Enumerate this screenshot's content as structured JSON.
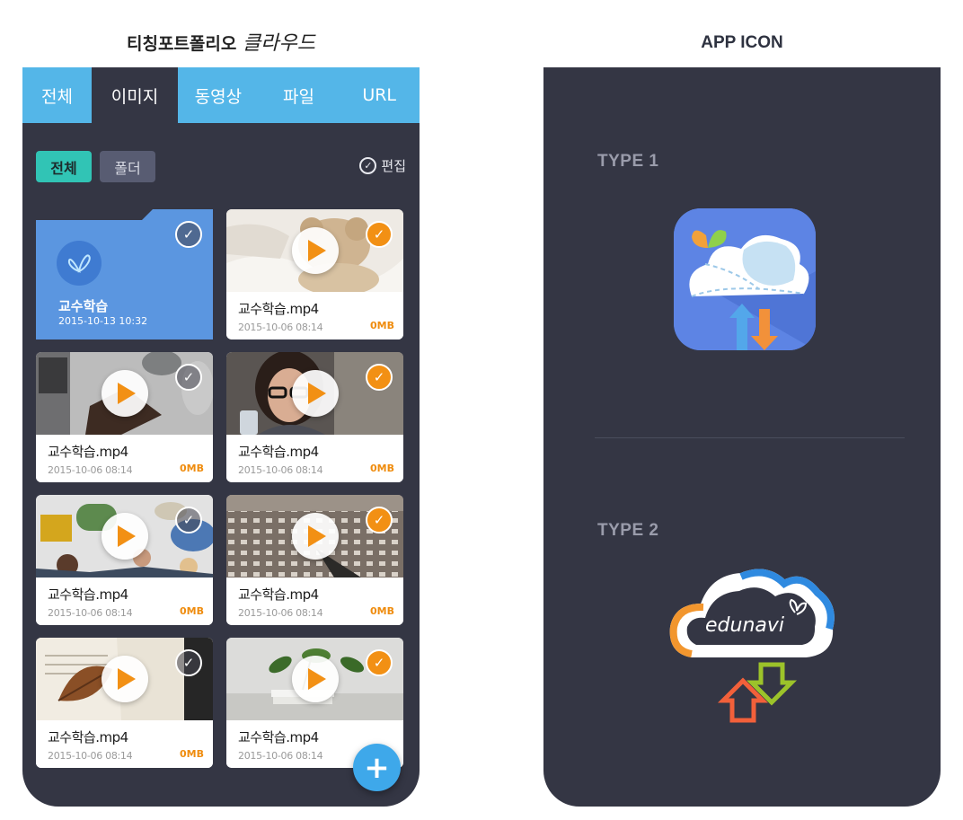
{
  "left_title": {
    "text": "티칭포트폴리오",
    "script": "클라우드"
  },
  "right_title": "APP ICON",
  "tabs": [
    {
      "label": "전체",
      "active": false
    },
    {
      "label": "이미지",
      "active": true
    },
    {
      "label": "동영상",
      "active": false
    },
    {
      "label": "파일",
      "active": false
    },
    {
      "label": "URL",
      "active": false
    }
  ],
  "filters": {
    "all": "전체",
    "folder": "폴더",
    "edit": "편집"
  },
  "folder": {
    "name": "교수학습",
    "date": "2015-10-13 10:32",
    "checked": false
  },
  "videos": [
    {
      "name": "교수학습.mp4",
      "date": "2015-10-06 08:14",
      "size": "0MB",
      "checked": true
    },
    {
      "name": "교수학습.mp4",
      "date": "2015-10-06 08:14",
      "size": "0MB",
      "checked": false
    },
    {
      "name": "교수학습.mp4",
      "date": "2015-10-06 08:14",
      "size": "0MB",
      "checked": true
    },
    {
      "name": "교수학습.mp4",
      "date": "2015-10-06 08:14",
      "size": "0MB",
      "checked": false
    },
    {
      "name": "교수학습.mp4",
      "date": "2015-10-06 08:14",
      "size": "0MB",
      "checked": true
    },
    {
      "name": "교수학습.mp4",
      "date": "2015-10-06 08:14",
      "size": "0MB",
      "checked": false
    },
    {
      "name": "교수학습.mp4",
      "date": "2015-10-06 08:14",
      "size": "",
      "checked": true
    }
  ],
  "fab": {
    "icon": "plus-icon",
    "glyph": "+"
  },
  "app_icons": {
    "type1_label": "TYPE 1",
    "type2_label": "TYPE 2",
    "type2_logo_text": "edunavi"
  },
  "colors": {
    "tab_bar": "#54b6e8",
    "background": "#343644",
    "accent_orange": "#f29014",
    "accent_teal": "#31c4b5",
    "folder_blue": "#5b96e0",
    "fab_blue": "#3ea8ea"
  }
}
